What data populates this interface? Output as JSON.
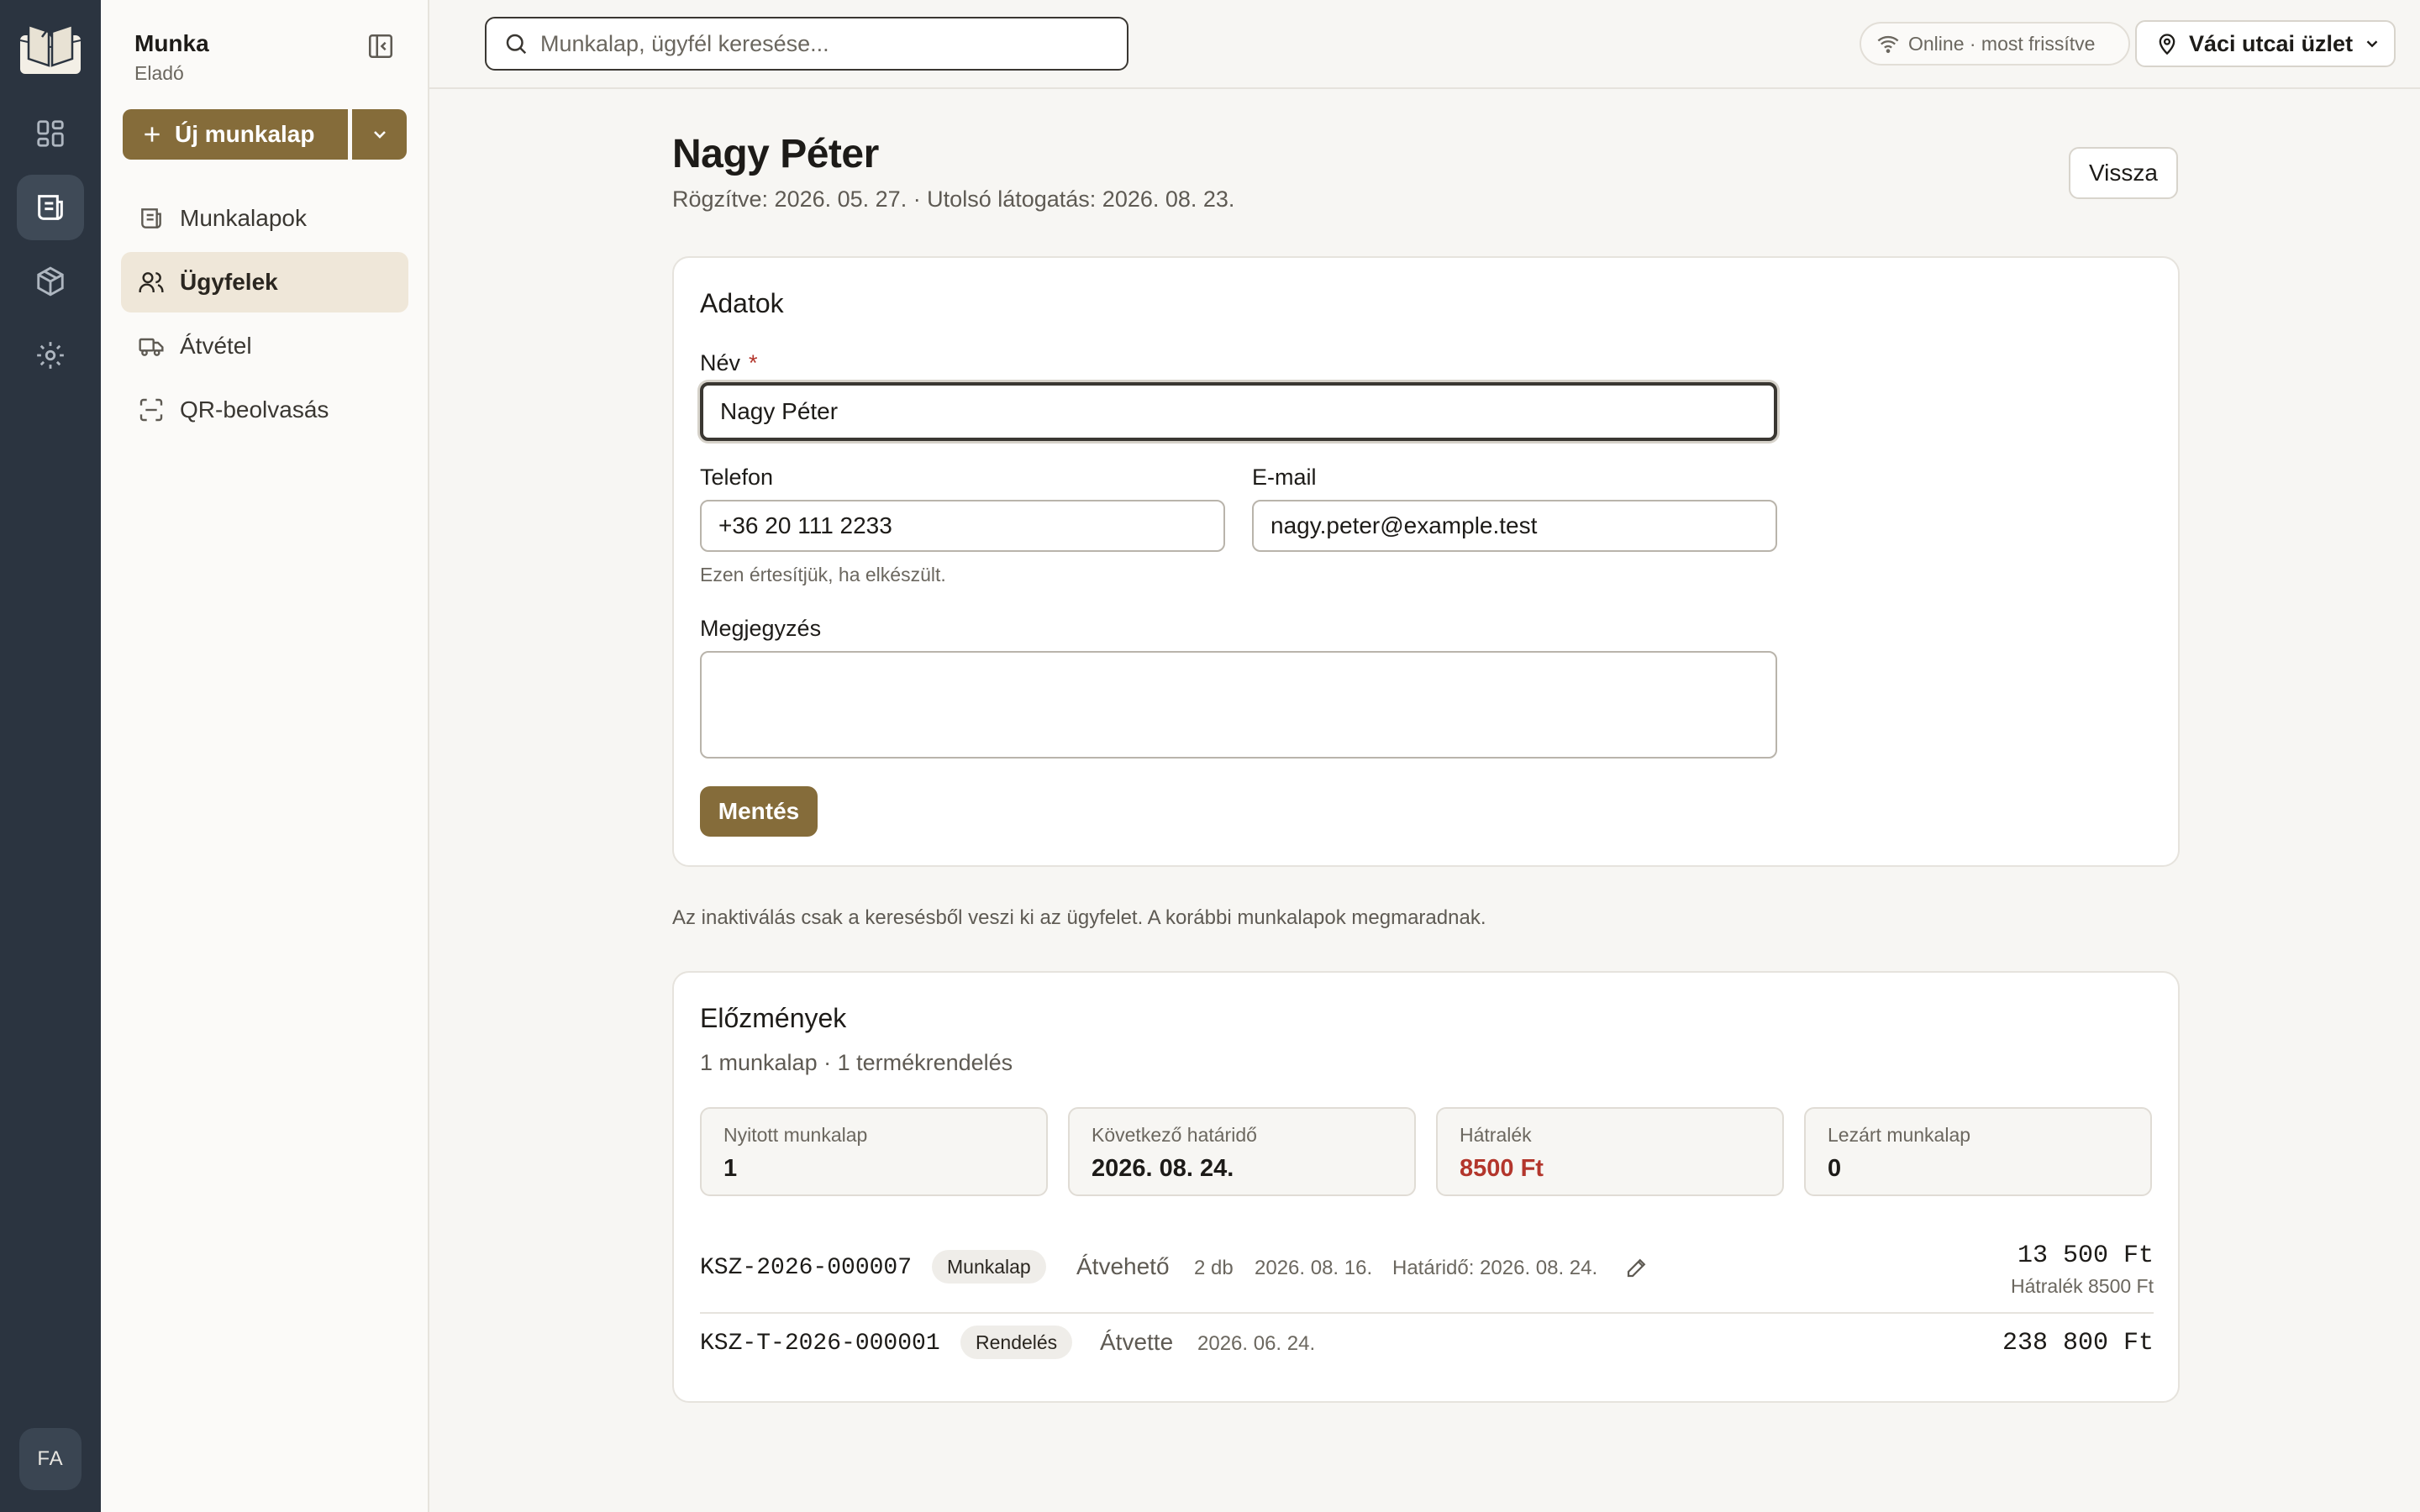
{
  "app": {
    "title": "Munka",
    "role": "Eladó",
    "user_initials": "FA"
  },
  "sidebar": {
    "new_button": "Új munkalap",
    "items": [
      {
        "label": "Munkalapok",
        "icon": "worksheet-icon"
      },
      {
        "label": "Ügyfelek",
        "icon": "users-icon",
        "active": true
      },
      {
        "label": "Átvétel",
        "icon": "truck-icon"
      },
      {
        "label": "QR-beolvasás",
        "icon": "qr-scan-icon"
      }
    ]
  },
  "topbar": {
    "search_placeholder": "Munkalap, ügyfél keresése...",
    "status": "Online · most frissítve",
    "store": "Váci utcai üzlet"
  },
  "page": {
    "title": "Nagy Péter",
    "meta": "Rögzítve: 2026. 05. 27. · Utolsó látogatás: 2026. 08. 23.",
    "back": "Vissza"
  },
  "form": {
    "section_title": "Adatok",
    "name_label": "Név",
    "name_required": "*",
    "name_value": "Nagy Péter",
    "phone_label": "Telefon",
    "phone_value": "+36 20 111 2233",
    "phone_hint": "Ezen értesítjük, ha elkészült.",
    "email_label": "E-mail",
    "email_value": "nagy.peter@example.test",
    "note_label": "Megjegyzés",
    "note_value": "",
    "save": "Mentés"
  },
  "inactive_note": "Az inaktiválás csak a keresésből veszi ki az ügyfelet. A korábbi munkalapok megmaradnak.",
  "history": {
    "title": "Előzmények",
    "counts": "1 munkalap · 1 termékrendelés",
    "stats": [
      {
        "label": "Nyitott munkalap",
        "value": "1"
      },
      {
        "label": "Következő határidő",
        "value": "2026. 08. 24."
      },
      {
        "label": "Hátralék",
        "value": "8500 Ft"
      },
      {
        "label": "Lezárt munkalap",
        "value": "0"
      }
    ],
    "rows": [
      {
        "code": "KSZ-2026-000007",
        "type": "Munkalap",
        "status": "Átvehető",
        "qty": "2 db",
        "date": "2026. 08. 16.",
        "deadline": "Határidő: 2026. 08. 24.",
        "amount": "13 500 Ft",
        "due": "Hátralék 8500 Ft"
      },
      {
        "code": "KSZ-T-2026-000001",
        "type": "Rendelés",
        "status": "Átvette",
        "date": "2026. 06. 24.",
        "amount": "238 800 Ft"
      }
    ]
  },
  "colors": {
    "accent": "#856c3a",
    "rail": "#2b3440",
    "danger": "#b3362c"
  }
}
